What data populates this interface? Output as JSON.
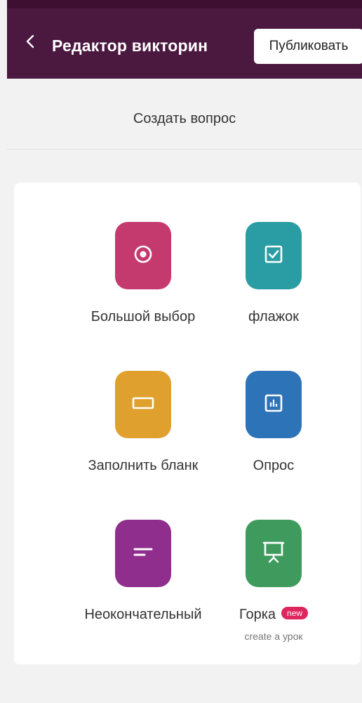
{
  "header": {
    "title": "Редактор викторин",
    "back_icon": "chevron-left-icon",
    "publish_label": "Публиковать",
    "bg_color": "#4b1840"
  },
  "subheader": {
    "title": "Создать вопрос"
  },
  "question_types": [
    {
      "label": "Большой выбор",
      "icon": "radio-icon",
      "color": "#c43a6e"
    },
    {
      "label": "флажок",
      "icon": "checkbox-icon",
      "color": "#2a9da4"
    },
    {
      "label": "Заполнить бланк",
      "icon": "blank-field-icon",
      "color": "#e0a02e"
    },
    {
      "label": "Опрос",
      "icon": "poll-chart-icon",
      "color": "#2d73b8"
    },
    {
      "label": "Неокончательный",
      "icon": "open-ended-icon",
      "color": "#8f2e8c"
    },
    {
      "label": "Горка",
      "icon": "presentation-icon",
      "color": "#3f9a5d",
      "badge": "new",
      "sublabel": "create a урок",
      "badge_color": "#e0245e"
    }
  ]
}
